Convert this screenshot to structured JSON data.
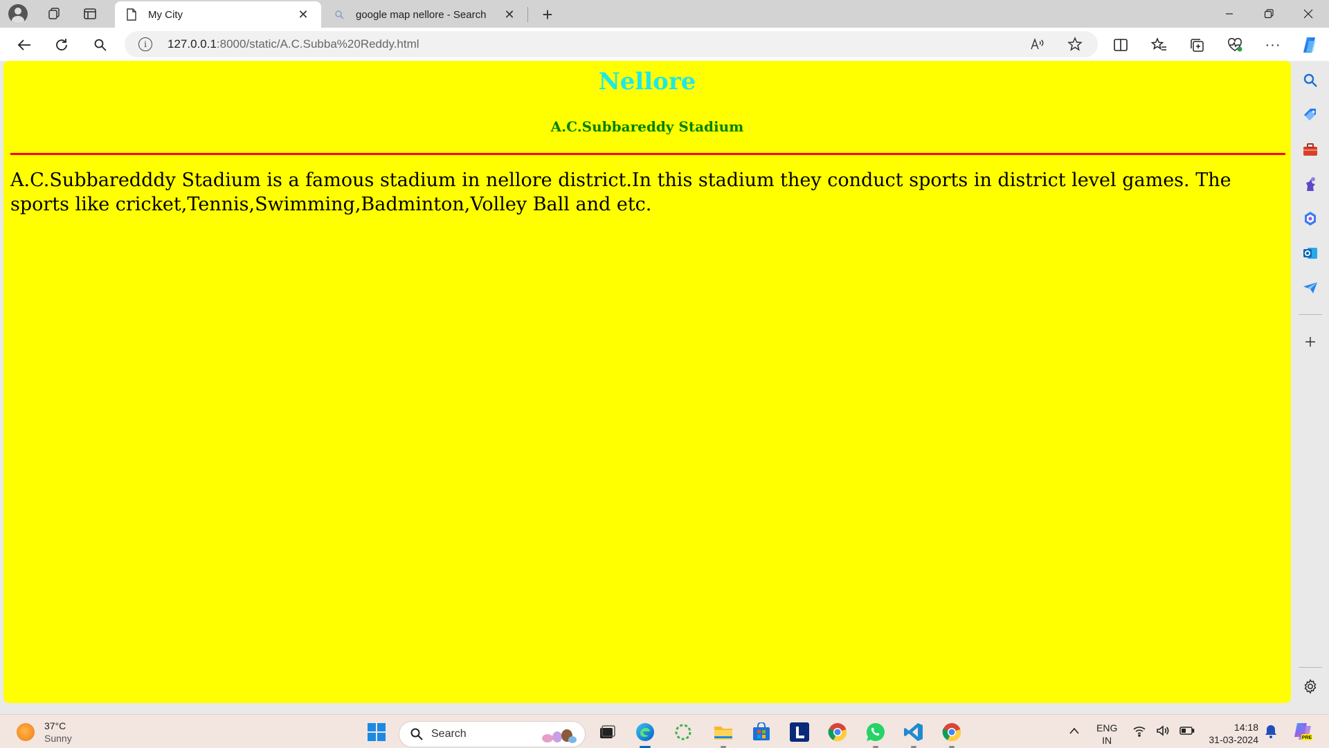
{
  "tabs": [
    {
      "title": "My City",
      "active": true
    },
    {
      "title": "google map nellore - Search",
      "active": false
    }
  ],
  "address_bar": {
    "url_host": "127.0.0.1",
    "url_rest": ":8000/static/A.C.Subba%20Reddy.html"
  },
  "page": {
    "background_color": "#ffff00",
    "heading": "Nellore",
    "heading_color": "#1ee8e8",
    "subheading": "A.C.Subbareddy Stadium",
    "subheading_color": "#008000",
    "rule_color": "#ff0000",
    "paragraph": "A.C.Subbaredddy Stadium is a famous stadium in nellore district.In this stadium they conduct sports in district level games. The sports like cricket,Tennis,Swimming,Badminton,Volley Ball and etc."
  },
  "sidebar": {
    "items": [
      "search-icon",
      "shopping-tag-icon",
      "tools-icon",
      "games-icon",
      "copilot-microsoft-365-icon",
      "outlook-icon",
      "drop-icon"
    ]
  },
  "taskbar": {
    "weather_temp": "37°C",
    "weather_desc": "Sunny",
    "search_label": "Search",
    "lang_top": "ENG",
    "lang_bottom": "IN",
    "time": "14:18",
    "date": "31-03-2024",
    "apps": [
      "start-icon",
      "task-view-icon",
      "edge-icon",
      "loop-icon",
      "file-explorer-icon",
      "store-icon",
      "l-app-icon",
      "chrome-icon",
      "whatsapp-icon",
      "vscode-icon",
      "chrome-icon-2"
    ]
  }
}
